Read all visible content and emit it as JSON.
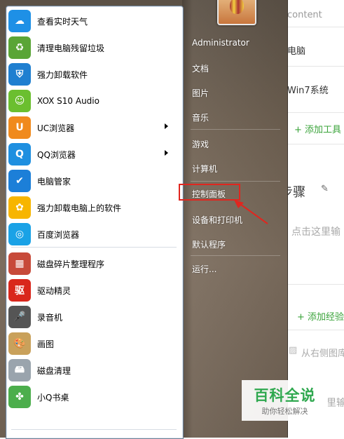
{
  "background_page": {
    "header_text": "content",
    "rows": [
      "电脑",
      "Win7系统"
    ],
    "add_tool": "+ 添加工具",
    "steps_label": "步骤",
    "click_here": "点击这里输",
    "add_experience": "+ 添加经验",
    "from_right_gallery": "从右侧图库",
    "bottom_text": "里输"
  },
  "start_menu": {
    "left_items": [
      {
        "label": "查看实时天气",
        "icon": "weather-icon",
        "color": "#1e90e6"
      },
      {
        "label": "清理电脑残留垃圾",
        "icon": "recycle-icon",
        "color": "#5aa536"
      },
      {
        "label": "强力卸载软件",
        "icon": "uninstall-shield-icon",
        "color": "#1f7fd0"
      },
      {
        "label": "XOX S10 Audio",
        "icon": "audio-icon",
        "color": "#6bbf2f"
      },
      {
        "label": "UC浏览器",
        "icon": "uc-browser-icon",
        "color": "#f08a1d",
        "submenu": true
      },
      {
        "label": "QQ浏览器",
        "icon": "qq-browser-icon",
        "color": "#1e8fe0",
        "submenu": true
      },
      {
        "label": "电脑管家",
        "icon": "pc-manager-icon",
        "color": "#1c7fd8"
      },
      {
        "label": "强力卸载电脑上的软件",
        "icon": "uninstall-pinwheel-icon",
        "color": "#f7b500"
      },
      {
        "label": "百度浏览器",
        "icon": "baidu-browser-icon",
        "color": "#1aa2e6"
      },
      {
        "label": "磁盘碎片整理程序",
        "icon": "defrag-icon",
        "color": "#c74a3a"
      },
      {
        "label": "驱动精灵",
        "icon": "driver-genius-icon",
        "color": "#d9271c"
      },
      {
        "label": "录音机",
        "icon": "microphone-icon",
        "color": "#555555"
      },
      {
        "label": "画图",
        "icon": "paint-palette-icon",
        "color": "#c9a15b"
      },
      {
        "label": "磁盘清理",
        "icon": "disk-cleanup-icon",
        "color": "#9aa4ad"
      },
      {
        "label": "小Q书桌",
        "icon": "q-desk-icon",
        "color": "#4cae4c"
      }
    ],
    "right_items": [
      "Administrator",
      "文档",
      "图片",
      "音乐",
      "游戏",
      "计算机",
      "控制面板",
      "设备和打印机",
      "默认程序",
      "运行..."
    ],
    "highlighted_item": "控制面板"
  },
  "watermark": {
    "title": "百科全说",
    "subtitle": "助你轻松解决"
  }
}
